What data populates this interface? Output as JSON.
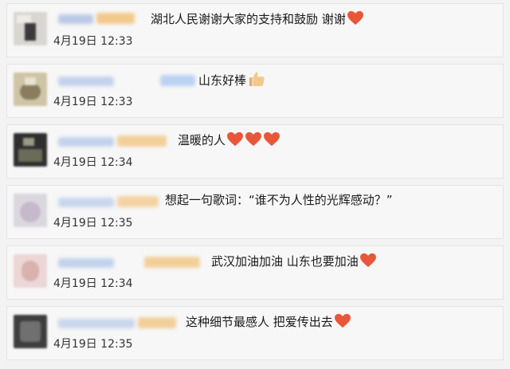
{
  "comments": [
    {
      "text": "湖北人民谢谢大家的支持和鼓励 谢谢",
      "date": "4月19日 12:33",
      "emojis": [
        "heart"
      ]
    },
    {
      "text": "山东好棒",
      "date": "4月19日 12:33",
      "emojis": [
        "thumbs-up"
      ]
    },
    {
      "text": "温暖的人",
      "date": "4月19日 12:34",
      "emojis": [
        "heart",
        "heart",
        "heart"
      ]
    },
    {
      "text": "想起一句歌词：“谁不为人性的光辉感动？”",
      "date": "4月19日 12:35",
      "emojis": []
    },
    {
      "text": "武汉加油加油 山东也要加油",
      "date": "4月19日 12:34",
      "emojis": [
        "heart"
      ]
    },
    {
      "text": "这种细节最感人 把爱传出去",
      "date": "4月19日 12:35",
      "emojis": [
        "heart"
      ]
    }
  ],
  "colors": {
    "heart": "#e8573a",
    "thumb": "#f2c98a",
    "card_bg": "#f7f7f7",
    "page_bg": "#f3f3f3"
  }
}
